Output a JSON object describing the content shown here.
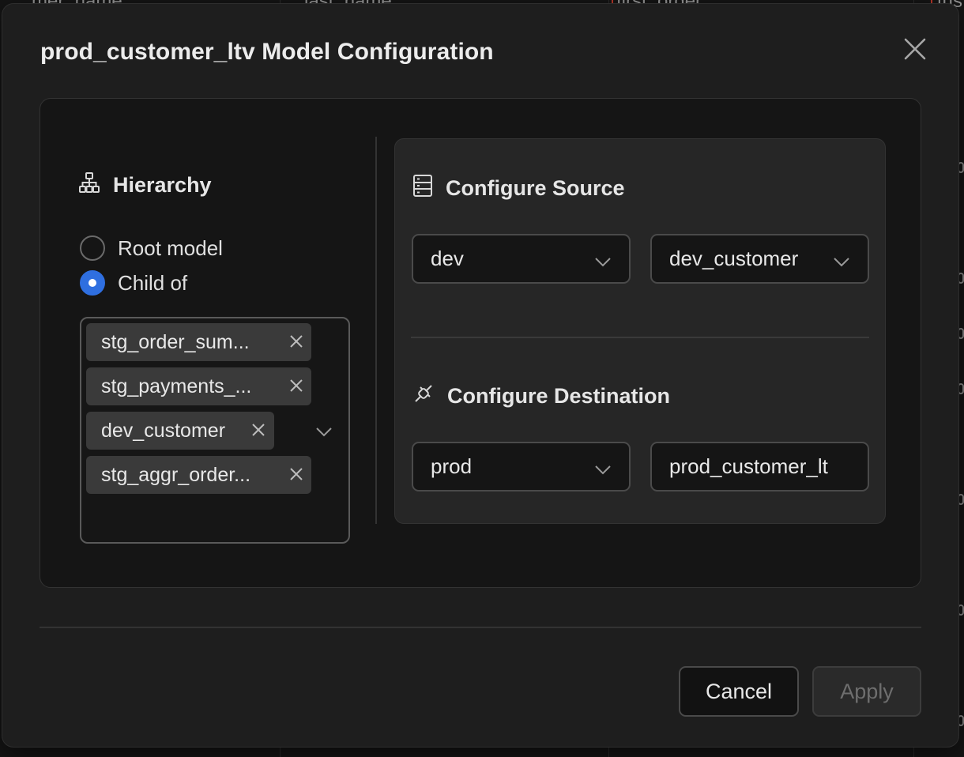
{
  "background": {
    "columns": [
      "mer_name",
      "last_name",
      "first_order",
      "tus"
    ]
  },
  "modal": {
    "title": "prod_customer_ltv Model Configuration",
    "close_icon": "close-icon"
  },
  "hierarchy": {
    "heading": "Hierarchy",
    "icon": "hierarchy-icon",
    "options": {
      "root": "Root model",
      "child": "Child of"
    },
    "selected": "child",
    "parents": [
      "stg_order_sum...",
      "stg_payments_...",
      "dev_customer",
      "stg_aggr_order..."
    ]
  },
  "source": {
    "heading": "Configure Source",
    "icon": "server-icon",
    "environment": "dev",
    "model": "dev_customer"
  },
  "destination": {
    "heading": "Configure Destination",
    "icon": "plug-icon",
    "environment": "prod",
    "model": "prod_customer_lt"
  },
  "footer": {
    "cancel_label": "Cancel",
    "apply_label": "Apply",
    "apply_disabled": true
  },
  "colors": {
    "accent": "#2f6fe0",
    "modal_bg": "#1e1e1e",
    "panel_bg": "#262626"
  }
}
